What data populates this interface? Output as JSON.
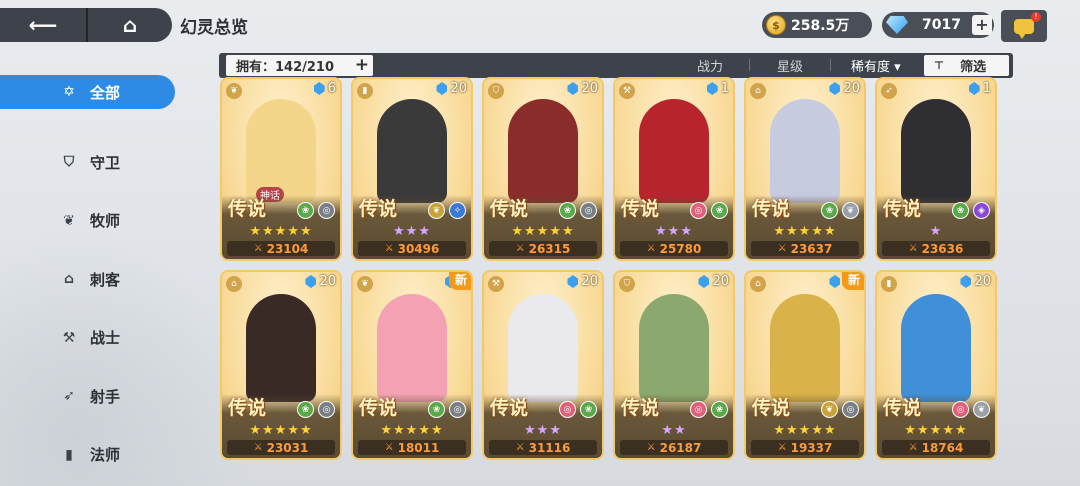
{
  "header": {
    "title": "幻灵总览",
    "gold": "258.5万",
    "gems": "7017",
    "notification": "!"
  },
  "sidebar": {
    "items": [
      {
        "label": "全部",
        "icon": "star-outline-icon",
        "glyph": "✡",
        "active": true
      },
      {
        "label": "守卫",
        "icon": "shield-icon",
        "glyph": "⛉",
        "active": false
      },
      {
        "label": "牧师",
        "icon": "wings-icon",
        "glyph": "❦",
        "active": false
      },
      {
        "label": "刺客",
        "icon": "assassin-icon",
        "glyph": "⌂",
        "active": false
      },
      {
        "label": "战士",
        "icon": "axe-icon",
        "glyph": "⚒",
        "active": false
      },
      {
        "label": "射手",
        "icon": "bow-icon",
        "glyph": "➶",
        "active": false
      },
      {
        "label": "法师",
        "icon": "book-icon",
        "glyph": "▮",
        "active": false
      }
    ]
  },
  "filter": {
    "owned_label": "拥有：142/210",
    "sort_power": "战力",
    "sort_stars": "星级",
    "sort_rarity": "稀有度 ▾",
    "filter_label": "筛选"
  },
  "cards": [
    {
      "level": "6",
      "rarity": "传说",
      "stars": "★★★★★",
      "star_color": "gold",
      "power": "23104",
      "is_new": false,
      "tag": "神话",
      "class_glyph": "❦",
      "elements": [
        [
          "#5aa84a",
          "❀"
        ],
        [
          "#7a7f86",
          "◎"
        ]
      ],
      "figure": "#f3d68a"
    },
    {
      "level": "20",
      "rarity": "传说",
      "stars": "★★★",
      "star_color": "purple",
      "power": "30496",
      "is_new": false,
      "tag": "",
      "class_glyph": "▮",
      "elements": [
        [
          "#c9a23a",
          "❦"
        ],
        [
          "#3a7ad6",
          "✧"
        ]
      ],
      "figure": "#3b3a3a"
    },
    {
      "level": "20",
      "rarity": "传说",
      "stars": "★★★★★",
      "star_color": "gold",
      "power": "26315",
      "is_new": false,
      "tag": "",
      "class_glyph": "⛉",
      "elements": [
        [
          "#5aa84a",
          "❀"
        ],
        [
          "#7a7f86",
          "◎"
        ]
      ],
      "figure": "#8a2d2a"
    },
    {
      "level": "1",
      "rarity": "传说",
      "stars": "★★★",
      "star_color": "purple",
      "power": "25780",
      "is_new": false,
      "tag": "",
      "class_glyph": "⚒",
      "elements": [
        [
          "#e0607a",
          "◎"
        ],
        [
          "#5aa84a",
          "❀"
        ]
      ],
      "figure": "#b8242e"
    },
    {
      "level": "20",
      "rarity": "传说",
      "stars": "★★★★★",
      "star_color": "gold",
      "power": "23637",
      "is_new": false,
      "tag": "",
      "class_glyph": "⌂",
      "elements": [
        [
          "#5aa84a",
          "❀"
        ],
        [
          "#9aa0a8",
          "❦"
        ]
      ],
      "figure": "#c7cbe0"
    },
    {
      "level": "1",
      "rarity": "传说",
      "stars": "★",
      "star_color": "purple",
      "power": "23636",
      "is_new": false,
      "tag": "",
      "class_glyph": "➶",
      "elements": [
        [
          "#5aa84a",
          "❀"
        ],
        [
          "#8a4ad6",
          "◈"
        ]
      ],
      "figure": "#2e2e33"
    },
    {
      "level": "20",
      "rarity": "传说",
      "stars": "★★★★★",
      "star_color": "gold",
      "power": "23031",
      "is_new": false,
      "tag": "",
      "class_glyph": "⌂",
      "elements": [
        [
          "#5aa84a",
          "❀"
        ],
        [
          "#7a7f86",
          "◎"
        ]
      ],
      "figure": "#3a2a26"
    },
    {
      "level": "6",
      "rarity": "传说",
      "stars": "★★★★★",
      "star_color": "gold",
      "power": "18011",
      "is_new": true,
      "tag": "",
      "class_glyph": "❦",
      "elements": [
        [
          "#5aa84a",
          "❀"
        ],
        [
          "#7a7f86",
          "◎"
        ]
      ],
      "figure": "#f4a2b3"
    },
    {
      "level": "20",
      "rarity": "传说",
      "stars": "★★★",
      "star_color": "purple",
      "power": "31116",
      "is_new": false,
      "tag": "",
      "class_glyph": "⚒",
      "elements": [
        [
          "#e0607a",
          "◎"
        ],
        [
          "#5aa84a",
          "❀"
        ]
      ],
      "figure": "#e9e9ee"
    },
    {
      "level": "20",
      "rarity": "传说",
      "stars": "★★",
      "star_color": "purple",
      "power": "26187",
      "is_new": false,
      "tag": "",
      "class_glyph": "⛉",
      "elements": [
        [
          "#e0607a",
          "◎"
        ],
        [
          "#5aa84a",
          "❀"
        ]
      ],
      "figure": "#8ba86e"
    },
    {
      "level": "20",
      "rarity": "传说",
      "stars": "★★★★★",
      "star_color": "gold",
      "power": "19337",
      "is_new": true,
      "tag": "",
      "class_glyph": "⌂",
      "elements": [
        [
          "#c9a23a",
          "❦"
        ],
        [
          "#7a7f86",
          "◎"
        ]
      ],
      "figure": "#d9b24a"
    },
    {
      "level": "20",
      "rarity": "传说",
      "stars": "★★★★★",
      "star_color": "gold",
      "power": "18764",
      "is_new": false,
      "tag": "",
      "class_glyph": "▮",
      "elements": [
        [
          "#e0607a",
          "◎"
        ],
        [
          "#9aa0a8",
          "❦"
        ]
      ],
      "figure": "#3f8fd9"
    }
  ]
}
